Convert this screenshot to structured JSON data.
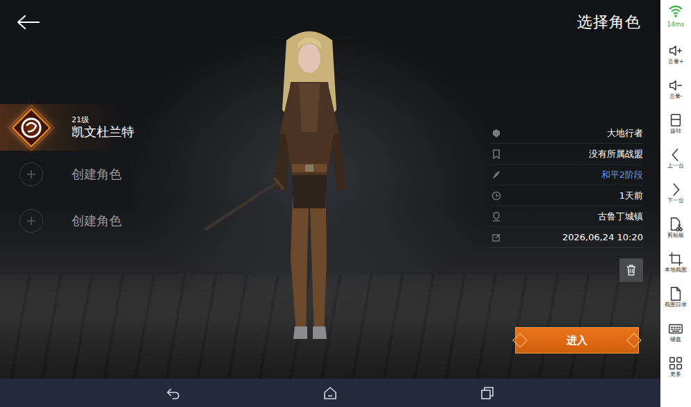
{
  "title": "选择角色",
  "characters": [
    {
      "kind": "character",
      "level": "21级",
      "name": "凯文杜兰特",
      "selected": true
    },
    {
      "kind": "empty",
      "label": "创建角色",
      "selected": false
    },
    {
      "kind": "empty",
      "label": "创建角色",
      "selected": false
    }
  ],
  "details": [
    {
      "text": "大地行者",
      "color": "#ffffff"
    },
    {
      "text": "没有所属战盟",
      "color": "#ffffff"
    },
    {
      "text": "和平2阶段",
      "color": "#6f95e0"
    },
    {
      "text": "1天前",
      "color": "#ffffff"
    },
    {
      "text": "古鲁丁城镇",
      "color": "#ffffff"
    },
    {
      "text": "2026,06,24 10:20",
      "color": "#ffffff"
    }
  ],
  "enter_button": "进入",
  "toolbar": {
    "ping": "14ms",
    "items": [
      {
        "label": "音量+"
      },
      {
        "label": "音量-"
      },
      {
        "label": "旋转"
      },
      {
        "label": "上一台"
      },
      {
        "label": "下一台"
      },
      {
        "label": "剪贴板"
      },
      {
        "label": "本地截图"
      },
      {
        "label": "截图目录"
      },
      {
        "label": "键盘"
      },
      {
        "label": "更多"
      }
    ]
  }
}
